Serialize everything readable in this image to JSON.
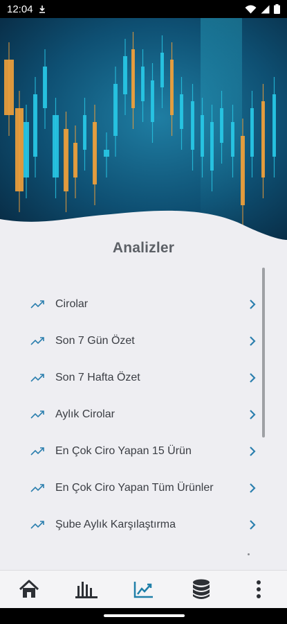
{
  "status_bar": {
    "time": "12:04",
    "icons": [
      "download-icon",
      "wifi-icon",
      "signal-icon",
      "battery-icon"
    ]
  },
  "page": {
    "title": "Analizler"
  },
  "analyses": [
    {
      "label": "Cirolar"
    },
    {
      "label": "Son 7 Gün Özet"
    },
    {
      "label": "Son 7 Hafta Özet"
    },
    {
      "label": "Aylık Cirolar"
    },
    {
      "label": "En Çok Ciro Yapan 15 Ürün"
    },
    {
      "label": "En Çok Ciro Yapan Tüm Ürünler"
    },
    {
      "label": "Şube Aylık Karşılaştırma"
    }
  ],
  "bottom_nav": {
    "items": [
      {
        "icon": "home-icon"
      },
      {
        "icon": "bar-chart-icon"
      },
      {
        "icon": "trending-up-icon",
        "active": true
      },
      {
        "icon": "database-icon"
      },
      {
        "icon": "more-vert-icon"
      }
    ],
    "active_color": "#1f7fa8",
    "inactive_color": "#2d3035"
  },
  "colors": {
    "accent": "#2b7fae",
    "hero_dark": "#07233a",
    "candle_orange": "#f2a13a",
    "candle_cyan": "#28c8e6"
  }
}
